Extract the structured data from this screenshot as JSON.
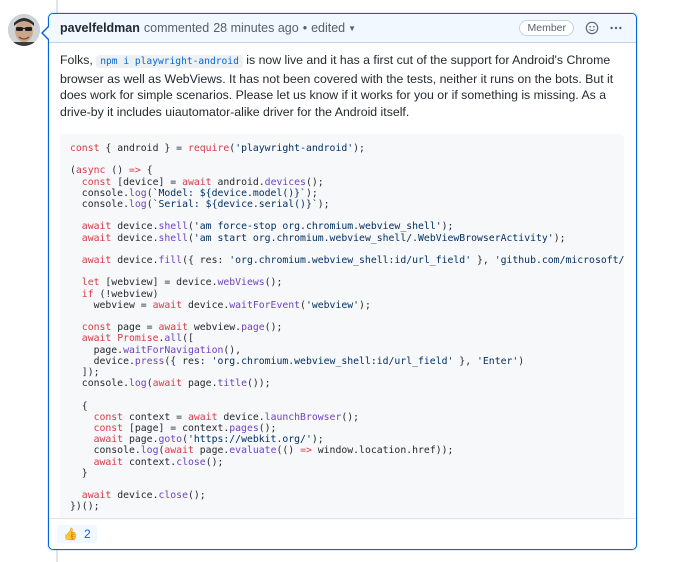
{
  "comment": {
    "author": "pavelfeldman",
    "action": "commented",
    "time": "28 minutes ago",
    "edited": "edited",
    "badge": "Member",
    "emoji_button": "smiley-icon",
    "more_button": "kebab-horizontal-icon",
    "body": {
      "before_code": "Folks,",
      "inline_code": "npm i playwright-android",
      "after_code": "is now live and it has a first cut of the support for Android's Chrome browser as well as WebViews. It has not been covered with the tests, neither it runs on the bots. But it does work for simple scenarios. Please let us know if it works for you or if something is missing. As a drive-by it includes uiautomator-alike driver for the Android itself."
    },
    "code_lines": [
      "const { android } = require('playwright-android');",
      "",
      "(async () => {",
      "  const [device] = await android.devices();",
      "  console.log(`Model: ${device.model()}`);",
      "  console.log(`Serial: ${device.serial()}`);",
      "",
      "  await device.shell('am force-stop org.chromium.webview_shell');",
      "  await device.shell('am start org.chromium.webview_shell/.WebViewBrowserActivity');",
      "",
      "  await device.fill({ res: 'org.chromium.webview_shell:id/url_field' }, 'github.com/microsoft/playwright');",
      "",
      "  let [webview] = device.webViews();",
      "  if (!webview)",
      "    webview = await device.waitForEvent('webview');",
      "",
      "  const page = await webview.page();",
      "  await Promise.all([",
      "    page.waitForNavigation(),",
      "    device.press({ res: 'org.chromium.webview_shell:id/url_field' }, 'Enter')",
      "  ]);",
      "  console.log(await page.title());",
      "",
      "  {",
      "    const context = await device.launchBrowser();",
      "    const [page] = context.pages();",
      "    await page.goto('https://webkit.org/');",
      "    console.log(await page.evaluate(() => window.location.href));",
      "    await context.close();",
      "  }",
      "",
      "  await device.close();",
      "})();"
    ],
    "reactions": [
      {
        "icon": "thumbs-up-icon",
        "emoji": "👍",
        "count": "2"
      }
    ]
  },
  "colors": {
    "accent": "#0366d6",
    "header_bg": "#f1f8ff",
    "code_bg": "#f6f8fa",
    "keyword": "#d73a49",
    "function": "#6f42c1",
    "string": "#032f62"
  }
}
